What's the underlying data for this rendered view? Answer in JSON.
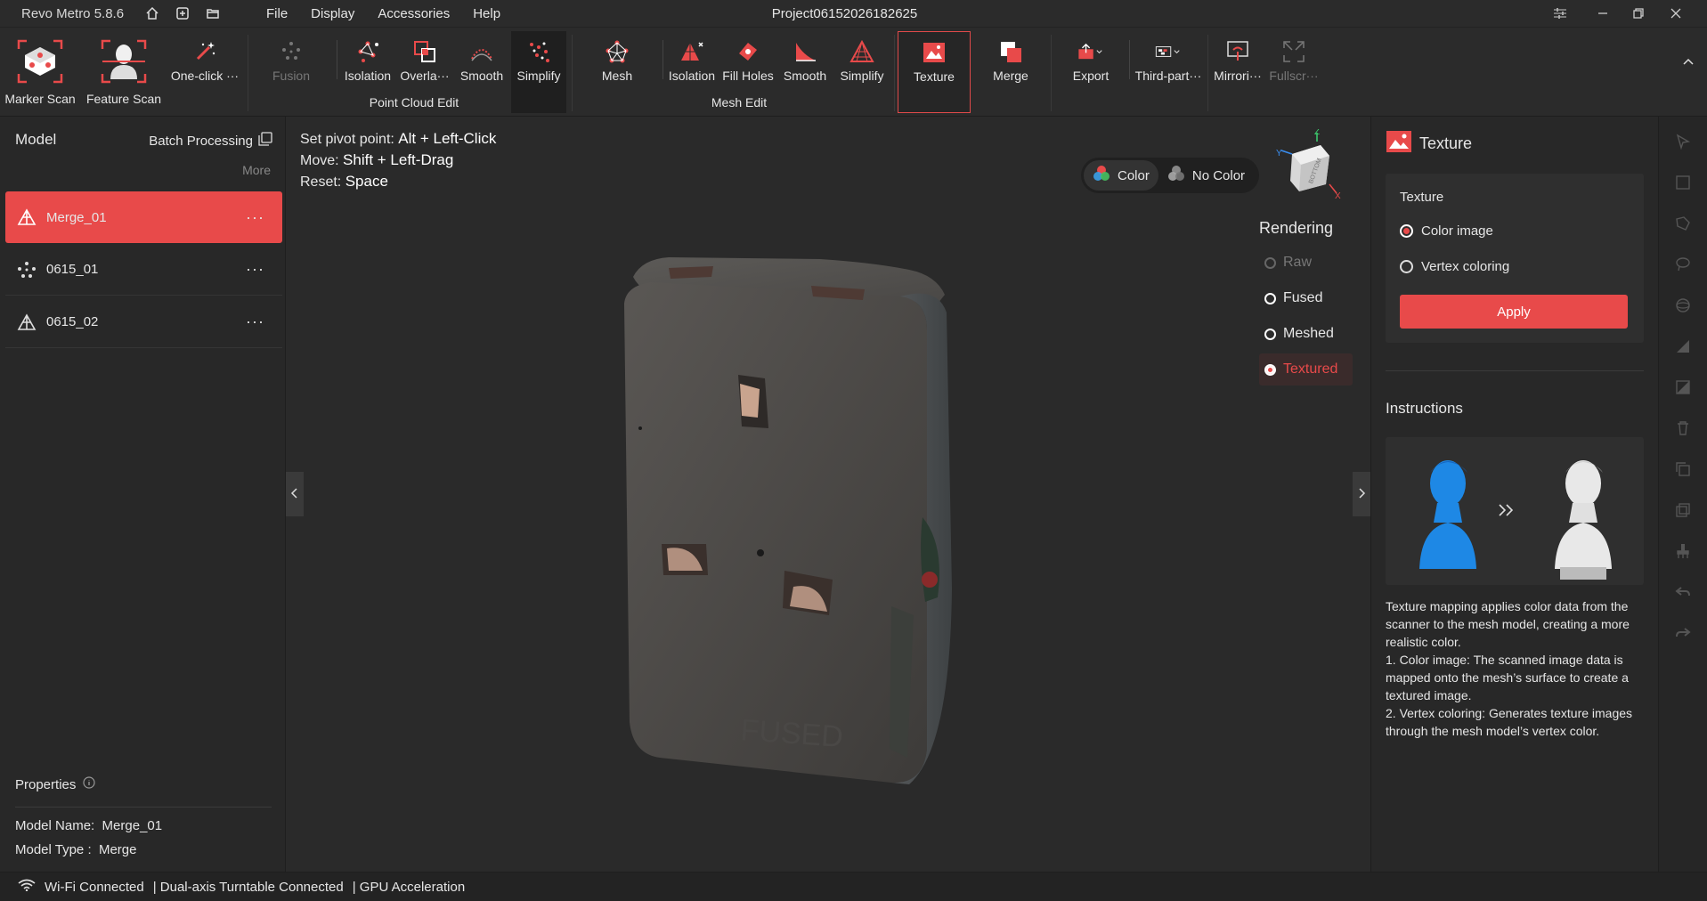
{
  "app": {
    "name": "Revo Metro 5.8.6",
    "project_title": "Project06152026182625"
  },
  "menu": [
    "File",
    "Display",
    "Accessories",
    "Help"
  ],
  "toolbar": {
    "marker_scan": "Marker Scan",
    "feature_scan": "Feature Scan",
    "one_click": "One-click ···",
    "fusion": "Fusion",
    "pc_isolation": "Isolation",
    "pc_overlap": "Overla···",
    "pc_smooth": "Smooth",
    "pc_simplify": "Simplify",
    "point_cloud_edit": "Point Cloud Edit",
    "mesh": "Mesh",
    "mesh_isolation": "Isolation",
    "fill_holes": "Fill Holes",
    "mesh_smooth": "Smooth",
    "mesh_simplify": "Simplify",
    "mesh_edit": "Mesh Edit",
    "texture": "Texture",
    "merge": "Merge",
    "export": "Export",
    "third_party": "Third-part···",
    "mirroring": "Mirrori···",
    "fullscreen": "Fullscr···"
  },
  "left_panel": {
    "title": "Model",
    "batch": "Batch Processing",
    "more": "More",
    "models": [
      {
        "name": "Merge_01",
        "type": "mesh"
      },
      {
        "name": "0615_01",
        "type": "pointcloud"
      },
      {
        "name": "0615_02",
        "type": "mesh"
      }
    ],
    "properties_title": "Properties",
    "model_name_label": "Model Name:",
    "model_name": "Merge_01",
    "model_type_label": "Model Type :",
    "model_type": "Merge"
  },
  "viewport": {
    "hints": [
      {
        "label": "Set pivot point:",
        "keys": "Alt + Left-Click"
      },
      {
        "label": "Move:",
        "keys": "Shift + Left-Drag"
      },
      {
        "label": "Reset:",
        "keys": "Space"
      }
    ],
    "color_on": "Color",
    "color_off": "No Color",
    "rendering_title": "Rendering",
    "rendering": [
      "Raw",
      "Fused",
      "Meshed",
      "Textured"
    ],
    "rendering_selected": "Textured",
    "gizmo_face": "BOTTOM",
    "object_text": "FUSED"
  },
  "right_panel": {
    "title": "Texture",
    "box_title": "Texture",
    "opt_color_image": "Color image",
    "opt_vertex": "Vertex coloring",
    "apply": "Apply",
    "instructions_title": "Instructions",
    "line1": "Texture mapping applies color data from the scanner to the mesh model, creating a more realistic color.",
    "line2": "1. Color image: The scanned image data is mapped onto the mesh’s surface to create a textured image.",
    "line3": "2. Vertex coloring: Generates texture images through the mesh model’s vertex color."
  },
  "status": {
    "wifi": "Wi-Fi Connected",
    "turntable": "| Dual-axis Turntable Connected",
    "gpu": "| GPU Acceleration"
  },
  "colors": {
    "accent": "#e84a4a",
    "panel": "#282828",
    "viewport": "#2a2a2a"
  }
}
